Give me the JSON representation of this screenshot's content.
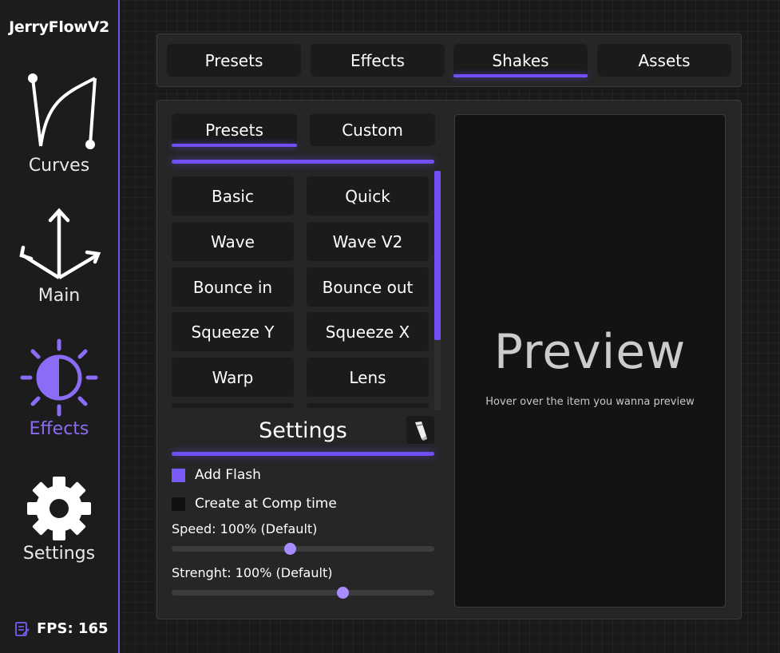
{
  "sidebar": {
    "app_title": "JerryFlowV2",
    "items": [
      {
        "label": "Curves",
        "icon": "curve-icon"
      },
      {
        "label": "Main",
        "icon": "arrows-icon"
      },
      {
        "label": "Effects",
        "icon": "sun-contrast-icon",
        "active": true
      },
      {
        "label": "Settings",
        "icon": "gear-icon"
      }
    ],
    "fps": "FPS: 165"
  },
  "top_tabs": [
    {
      "label": "Presets"
    },
    {
      "label": "Effects"
    },
    {
      "label": "Shakes",
      "active": true
    },
    {
      "label": "Assets"
    }
  ],
  "sub_tabs": [
    {
      "label": "Presets",
      "active": true
    },
    {
      "label": "Custom"
    }
  ],
  "presets": [
    "Basic",
    "Quick",
    "Wave",
    "Wave V2",
    "Bounce in",
    "Bounce out",
    "Squeeze Y",
    "Squeeze X",
    "Warp",
    "Lens"
  ],
  "settings": {
    "title": "Settings",
    "add_flash": {
      "label": "Add Flash",
      "checked": true
    },
    "create_at_comp": {
      "label": "Create at Comp time",
      "checked": false
    },
    "speed": {
      "label": "Speed: 100% (Default)",
      "value_fraction": 0.45
    },
    "strength": {
      "label": "Strenght: 100% (Default)",
      "value_fraction": 0.65
    }
  },
  "preview": {
    "title": "Preview",
    "hint": "Hover over the  item you wanna preview"
  },
  "colors": {
    "accent": "#7050f5",
    "accent_light": "#a68cff",
    "background": "#1a1a1a",
    "panel": "#262626"
  }
}
